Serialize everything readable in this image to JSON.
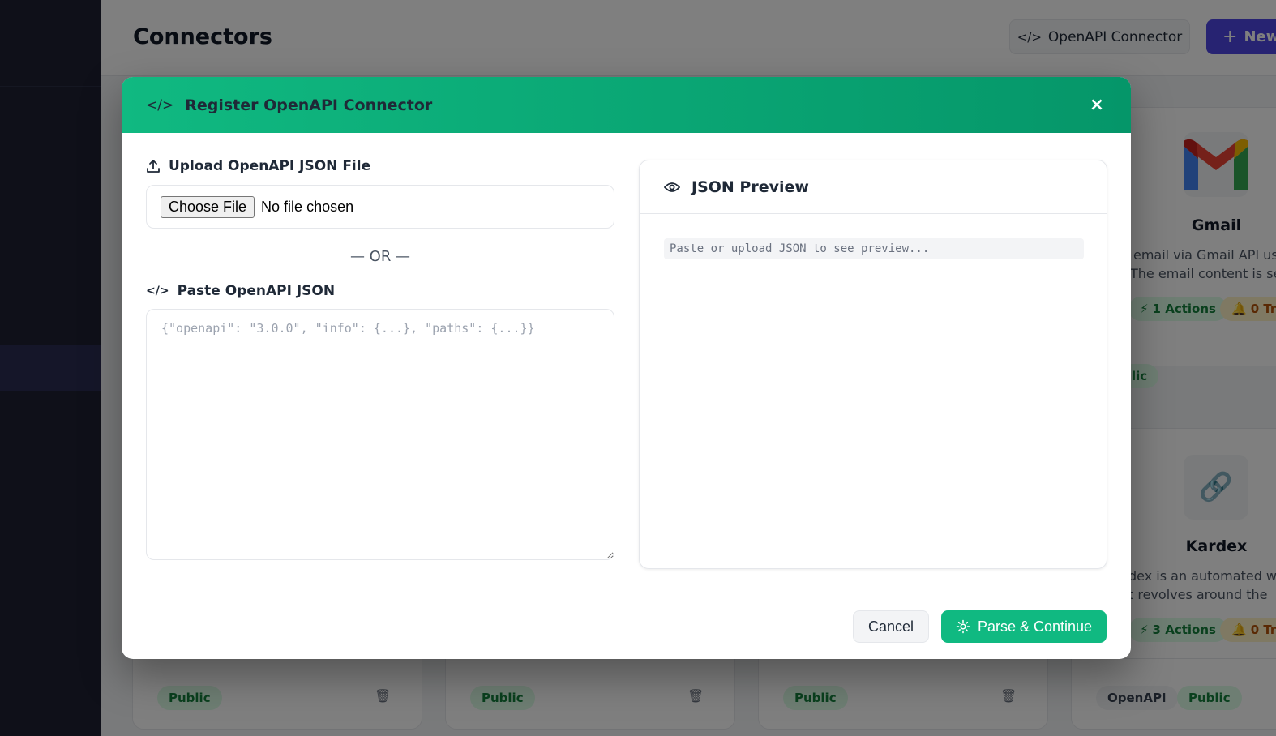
{
  "page": {
    "title": "Connectors",
    "openapi_button_label": "OpenAPI Connector",
    "new_button_label": "New"
  },
  "cards": [
    {
      "name": "Gmail",
      "description_line1": "email via Gmail API us",
      "description_line2": "The email content is se",
      "actions_badge": "1 Actions",
      "triggers_badge": "0 Tri",
      "tag": "lic"
    },
    {
      "name": "Kardex",
      "description_line1": "dex is an automated wa",
      "description_line2": "t revolves around the",
      "actions_badge": "3 Actions",
      "triggers_badge": "0 Tri"
    }
  ],
  "bottom_cards": [
    {
      "tag": "Public"
    },
    {
      "tag": "Public"
    },
    {
      "tag": "Public"
    },
    {
      "tag1": "OpenAPI",
      "tag2": "Public"
    }
  ],
  "modal": {
    "title": "Register OpenAPI Connector",
    "close_symbol": "×",
    "upload_label": "Upload OpenAPI JSON File",
    "choose_file_label": "Choose File",
    "no_file_text": "No file chosen",
    "or_separator": "— OR —",
    "paste_label": "Paste OpenAPI JSON",
    "json_placeholder": "{\"openapi\": \"3.0.0\", \"info\": {...}, \"paths\": {...}}",
    "preview_title": "JSON Preview",
    "preview_placeholder": "Paste or upload JSON to see preview...",
    "cancel_label": "Cancel",
    "parse_label": "Parse & Continue"
  },
  "colors": {
    "header_gradient_start": "#10b981",
    "header_gradient_end": "#059669",
    "primary": "#10b981",
    "sidebar": "#1e2033",
    "new_button": "#4f46e5"
  }
}
